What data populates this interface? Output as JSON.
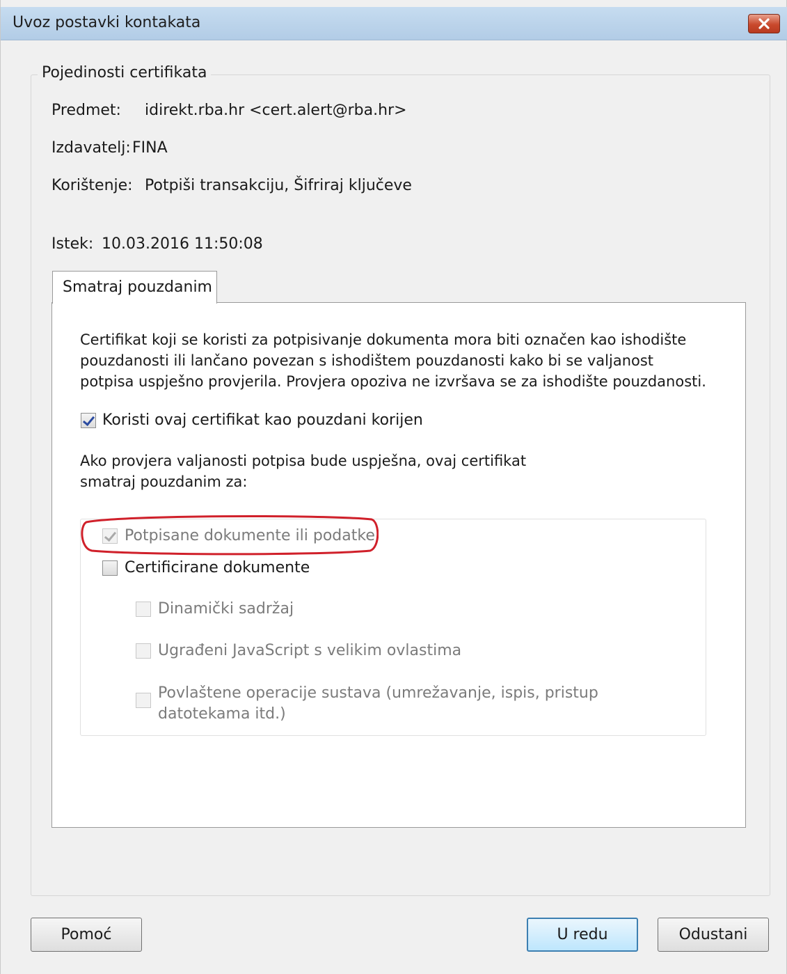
{
  "window": {
    "title": "Uvoz postavki kontakata",
    "close_icon": "close-icon"
  },
  "certificate": {
    "group_title": "Pojedinosti certifikata",
    "subject_label": "Predmet:",
    "subject_value": "idirekt.rba.hr <cert.alert@rba.hr>",
    "issuer_label": "Izdavatelj:",
    "issuer_value": "FINA",
    "usage_label": "Korištenje:",
    "usage_value": "Potpiši transakciju, Šifriraj ključeve",
    "expiry_label": "Istek:",
    "expiry_value": "10.03.2016 11:50:08"
  },
  "trust_tab": {
    "label": "Smatraj pouzdanim",
    "description_lines": [
      "Certifikat koji se koristi za potpisivanje dokumenta mora biti označen kao ishodište",
      "pouzdanosti ili lančano povezan s ishodištem pouzdanosti kako bi se valjanost",
      "potpisa uspješno provjerila. Provjera opoziva ne izvršava se za ishodište pouzdanosti."
    ],
    "root_checkbox": {
      "label": "Koristi ovaj certifikat kao pouzdani korijen",
      "checked": true
    },
    "trust_for_lines": [
      "Ako provjera valjanosti potpisa bude uspješna, ovaj certifikat",
      "smatraj pouzdanim za:"
    ],
    "options": {
      "signed": {
        "label": "Potpisane dokumente ili podatke",
        "checked": true,
        "enabled": false
      },
      "certified": {
        "label": "Certificirane dokumente",
        "checked": false,
        "enabled": true
      },
      "dynamic": {
        "label": "Dinamički sadržaj",
        "checked": false,
        "enabled": false
      },
      "javascript": {
        "label": "Ugrađeni JavaScript s velikim ovlastima",
        "checked": false,
        "enabled": false
      },
      "privileged": {
        "label_lines": [
          "Povlaštene operacije sustava (umrežavanje, ispis, pristup",
          "datotekama itd.)"
        ],
        "checked": false,
        "enabled": false
      }
    },
    "highlight_color": "#d0202a"
  },
  "buttons": {
    "help": "Pomoć",
    "ok": "U redu",
    "cancel": "Odustani"
  }
}
